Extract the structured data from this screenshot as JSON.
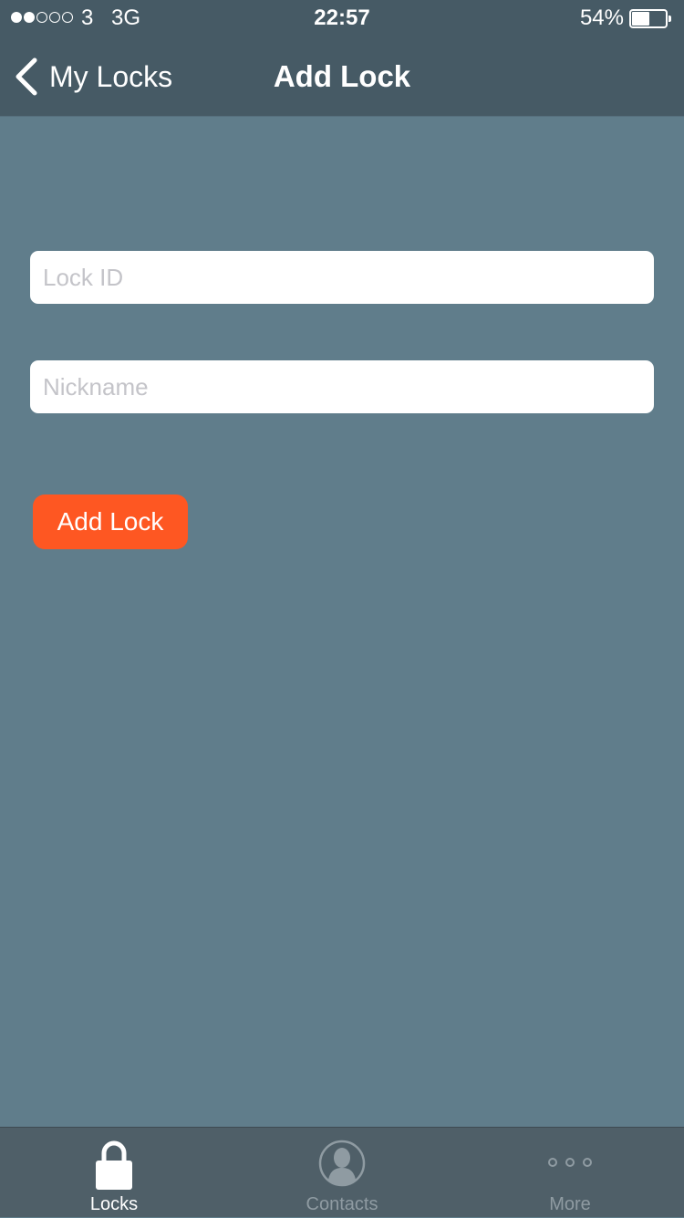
{
  "status_bar": {
    "signal_bars_filled": 2,
    "signal_bars_total": 5,
    "carrier": "3",
    "network": "3G",
    "time": "22:57",
    "battery_percent_label": "54%",
    "battery_level": 0.54
  },
  "nav": {
    "back_label": "My Locks",
    "title": "Add Lock"
  },
  "form": {
    "lock_id": {
      "value": "",
      "placeholder": "Lock ID"
    },
    "nickname": {
      "value": "",
      "placeholder": "Nickname"
    },
    "submit_label": "Add Lock"
  },
  "tabs": [
    {
      "label": "Locks",
      "icon": "lock-icon",
      "active": true
    },
    {
      "label": "Contacts",
      "icon": "contacts-icon",
      "active": false
    },
    {
      "label": "More",
      "icon": "more-icon",
      "active": false
    }
  ],
  "colors": {
    "background": "#607d8b",
    "header": "#465a65",
    "accent": "#fe5722",
    "tab_bar": "#4f5f68"
  }
}
